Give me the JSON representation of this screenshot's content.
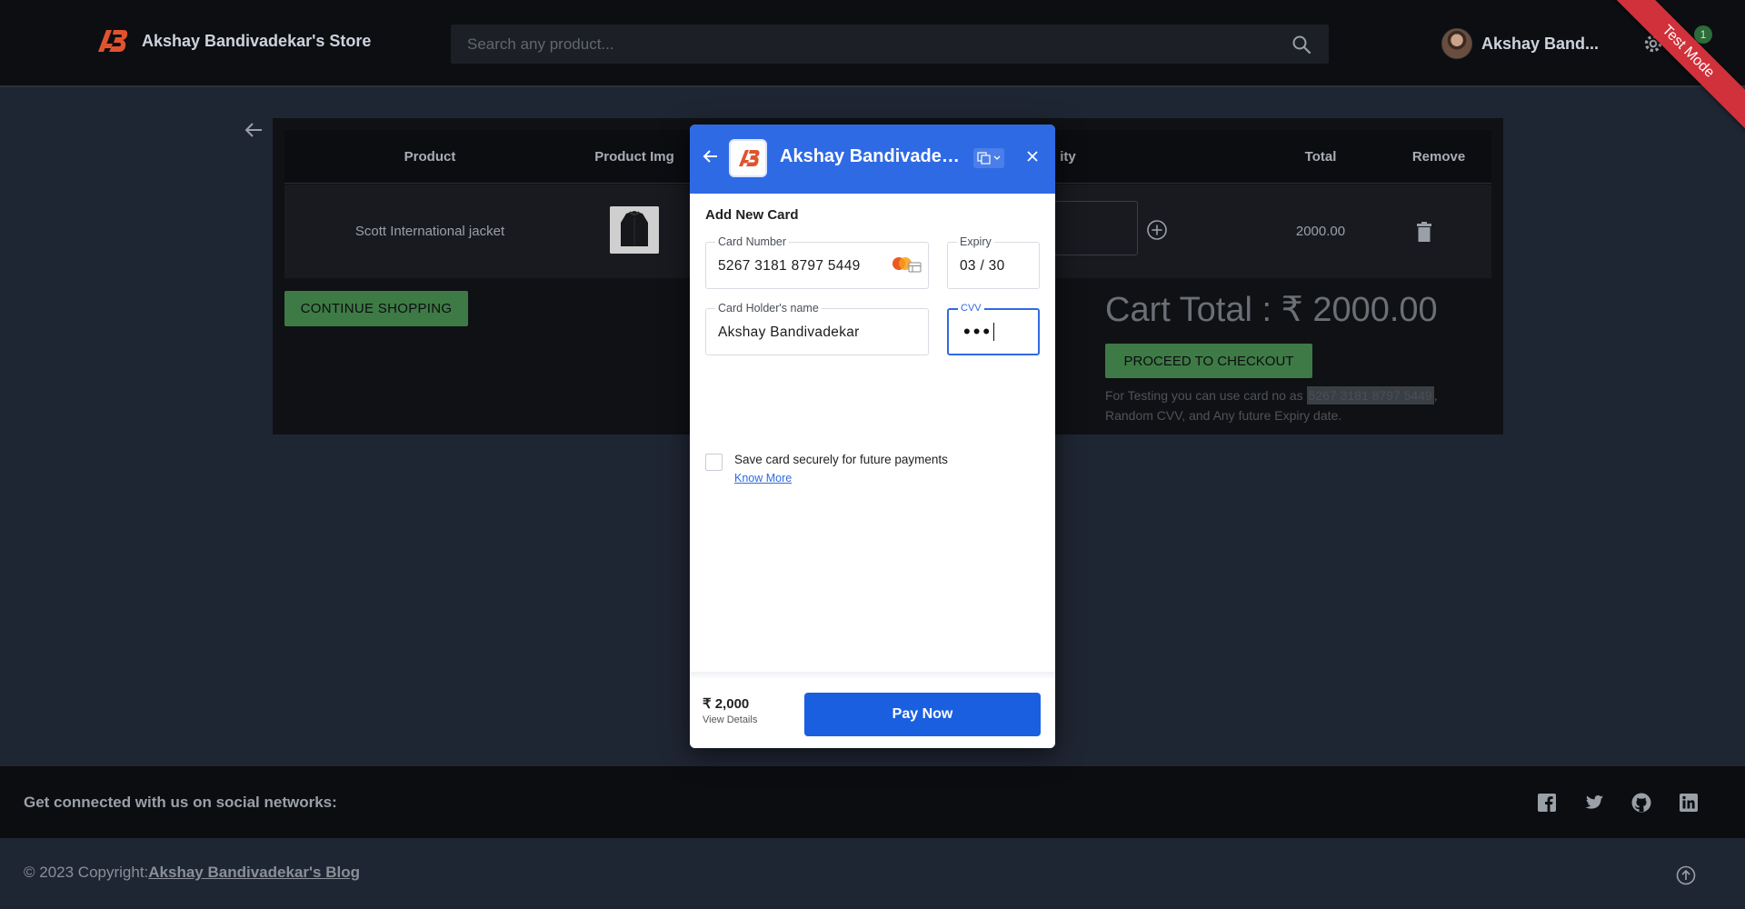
{
  "header": {
    "store_name": "Akshay Bandivadekar's Store",
    "search_placeholder": "Search any product...",
    "user_name": "Akshay Band...",
    "notification_count": "1",
    "test_mode": "Test Mode"
  },
  "cart": {
    "columns": [
      "Product",
      "Product Img",
      "ity",
      "Total",
      "Remove"
    ],
    "rows": [
      {
        "product": "Scott International jacket",
        "total": "2000.00"
      }
    ],
    "continue_label": "CONTINUE SHOPPING",
    "cart_total": "Cart Total : ₹ 2000.00",
    "checkout_label": "PROCEED TO CHECKOUT",
    "test_note_pre": "For Testing you can use card no as ",
    "test_note_card": "5267 3181 8797 5449",
    "test_note_post": ", Random CVV, and Any future Expiry date."
  },
  "modal": {
    "title": "Akshay Bandivadek...",
    "heading": "Add New Card",
    "card_number": {
      "label": "Card Number",
      "value": "5267 3181 8797 5449"
    },
    "expiry": {
      "label": "Expiry",
      "value": "03 / 30"
    },
    "holder": {
      "label": "Card Holder's name",
      "value": "Akshay Bandivadekar"
    },
    "cvv": {
      "label": "CVV",
      "value": "•••"
    },
    "save_label": "Save card securely for future payments",
    "know_more": "Know More",
    "amount": "₹ 2,000",
    "view_details": "View Details",
    "pay_label": "Pay Now"
  },
  "footer": {
    "social_text": "Get connected with us on social networks:",
    "copyright_prefix": "© 2023 Copyright:",
    "copyright_link": "Akshay Bandivadekar's Blog"
  },
  "icons": {
    "social": [
      "facebook-icon",
      "twitter-icon",
      "github-icon",
      "linkedin-icon"
    ]
  },
  "colors": {
    "razorpay_blue": "#2f6ae5",
    "pay_button": "#1a5fe0",
    "green_button": "#3e7a45",
    "ribbon_red": "#d0313a"
  }
}
